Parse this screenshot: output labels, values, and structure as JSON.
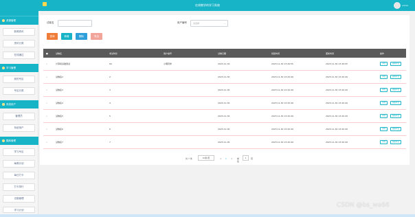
{
  "app": {
    "title": "在线教学的学习系统",
    "user": "admin"
  },
  "sidebar": {
    "home": "我的桌面",
    "s1": "资源管理",
    "s1_items": [
      "新闻资讯",
      "资讯分类",
      "在线通过"
    ],
    "s2": "学习管理",
    "s2_items": [
      "我的专区",
      "专区分类"
    ],
    "s3": "系统用户",
    "s3_items": [
      "管理员",
      "系统用户"
    ],
    "s4": "题库管理",
    "s4_items": [
      "学习专区",
      "每周计划",
      "每日打卡",
      "打卡排行",
      "试卷管理",
      "学习计划"
    ]
  },
  "filters": {
    "name_label": "试卷名",
    "name_placeholder": "",
    "user_label": "用户编号",
    "user_placeholder": "请选择"
  },
  "buttons": {
    "search": "查询",
    "add": "新增",
    "delete": "删除",
    "export": "导出"
  },
  "table": {
    "headers": [
      "",
      "试卷名",
      "考试时长",
      "用户编号",
      "试卷日期",
      "创建时间",
      "更新时间",
      "操作"
    ],
    "rows": [
      {
        "name": "计算机基础测试",
        "duration": "60",
        "user": "小明同学",
        "date": "2023-11-30",
        "created": "2023-11-30 13:49:55",
        "updated": "2023-11-30 13:49:55"
      },
      {
        "name": "试卷名2",
        "duration": "2",
        "user": "",
        "date": "2023-11-30",
        "created": "2023-11-30 13:20:49",
        "updated": "2023-11-30 13:20:49"
      },
      {
        "name": "试卷名3",
        "duration": "3",
        "user": "",
        "date": "2023-11-30",
        "created": "2023-11-30 13:20:49",
        "updated": "2023-11-30 13:20:49"
      },
      {
        "name": "试卷名4",
        "duration": "4",
        "user": "",
        "date": "2023-11-30",
        "created": "2023-11-30 13:20:49",
        "updated": "2023-11-30 13:20:49"
      },
      {
        "name": "试卷名5",
        "duration": "5",
        "user": "",
        "date": "2023-11-30",
        "created": "2023-11-30 13:20:49",
        "updated": "2023-11-30 13:20:49"
      },
      {
        "name": "试卷名6",
        "duration": "6",
        "user": "",
        "date": "2023-11-30",
        "created": "2023-11-30 13:20:49",
        "updated": "2023-11-30 13:20:49"
      },
      {
        "name": "试卷名7",
        "duration": "7",
        "user": "",
        "date": "2023-11-30",
        "created": "2023-11-30 13:20:49",
        "updated": "2023-11-30 13:20:49"
      }
    ],
    "ops": {
      "detail": "详情",
      "edit": "编辑考试"
    }
  },
  "pager": {
    "total": "共 7 条",
    "size": "10条/页",
    "prev": "<",
    "page": "1",
    "next": ">",
    "goto": "前往",
    "goto_page": "1",
    "unit": "页"
  },
  "watermark": "CSDN @bs_wa66",
  "colors": {
    "teal": "#17b3c7",
    "orange": "#f07c3a",
    "blue": "#2e9fd8",
    "pink": "#f2a39a"
  }
}
